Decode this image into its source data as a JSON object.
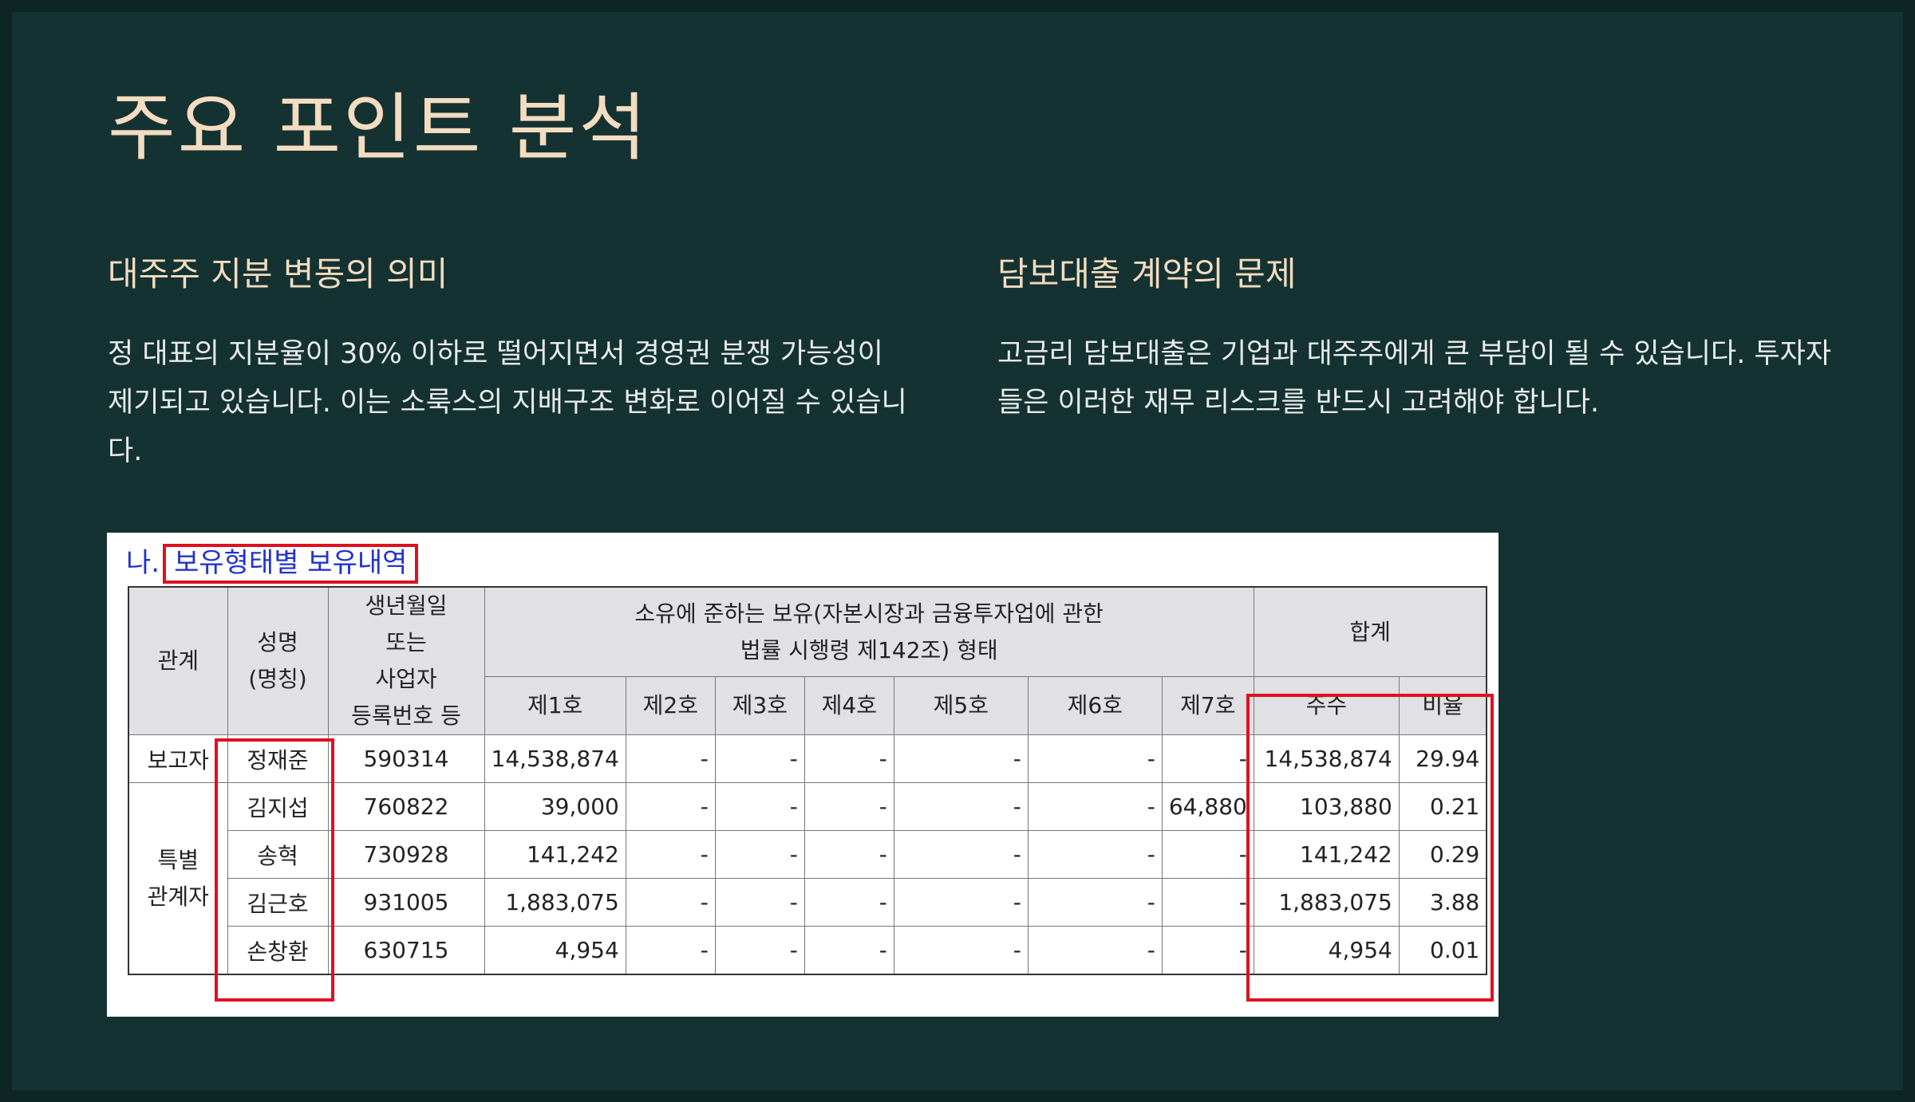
{
  "title": "주요 포인트 분석",
  "left": {
    "heading": "대주주 지분 변동의 의미",
    "body": "정 대표의 지분율이 30% 이하로 떨어지면서 경영권 분쟁 가능성이 제기되고 있습니다. 이는 소룩스의 지배구조 변화로 이어질 수 있습니다."
  },
  "right": {
    "heading": "담보대출 계약의 문제",
    "body": "고금리 담보대출은 기업과 대주주에게 큰 부담이 될 수 있습니다. 투자자들은 이러한 재무 리스크를 반드시 고려해야 합니다."
  },
  "table": {
    "caption_prefix": "나.",
    "caption_title": "보유형태별 보유내역",
    "headers": {
      "relation": "관계",
      "name": "성명\n(명칭)",
      "birth": "생년월일\n또는\n사업자\n등록번호 등",
      "form": "소유에 준하는 보유(자본시장과 금융투자업에 관한\n법률 시행령 제142조) 형태",
      "total": "합계",
      "forms": [
        "제1호",
        "제2호",
        "제3호",
        "제4호",
        "제5호",
        "제6호",
        "제7호"
      ],
      "shares": "주수",
      "ratio": "비율"
    },
    "groups": {
      "reporter": "보고자",
      "special": "특별\n관계자"
    },
    "rows": [
      {
        "name": "정재준",
        "birth": "590314",
        "c1": "14,538,874",
        "c2": "-",
        "c3": "-",
        "c4": "-",
        "c5": "-",
        "c6": "-",
        "c7": "-",
        "shares": "14,538,874",
        "ratio": "29.94"
      },
      {
        "name": "김지섭",
        "birth": "760822",
        "c1": "39,000",
        "c2": "-",
        "c3": "-",
        "c4": "-",
        "c5": "-",
        "c6": "-",
        "c7": "64,880",
        "shares": "103,880",
        "ratio": "0.21"
      },
      {
        "name": "송혁",
        "birth": "730928",
        "c1": "141,242",
        "c2": "-",
        "c3": "-",
        "c4": "-",
        "c5": "-",
        "c6": "-",
        "c7": "-",
        "shares": "141,242",
        "ratio": "0.29"
      },
      {
        "name": "김근호",
        "birth": "931005",
        "c1": "1,883,075",
        "c2": "-",
        "c3": "-",
        "c4": "-",
        "c5": "-",
        "c6": "-",
        "c7": "-",
        "shares": "1,883,075",
        "ratio": "3.88"
      },
      {
        "name": "손창환",
        "birth": "630715",
        "c1": "4,954",
        "c2": "-",
        "c3": "-",
        "c4": "-",
        "c5": "-",
        "c6": "-",
        "c7": "-",
        "shares": "4,954",
        "ratio": "0.01"
      }
    ]
  }
}
